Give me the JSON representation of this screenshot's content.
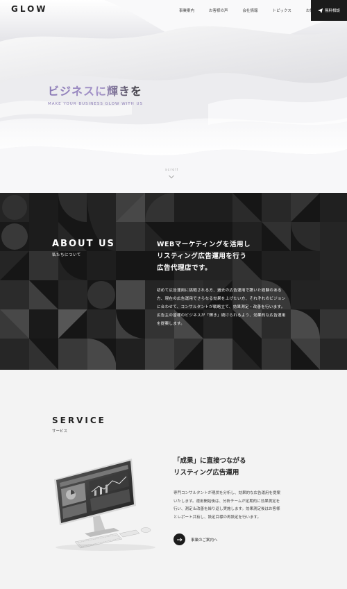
{
  "header": {
    "logo": "GLOW",
    "nav": [
      "事業案内",
      "お客様の声",
      "会社情報",
      "トピックス",
      "お知らせ"
    ],
    "cta_label": "無料相談"
  },
  "hero": {
    "title": "ビジネスに輝きを",
    "subtitle": "MAKE YOUR BUSINESS GLOW WITH US",
    "scroll": "scroll"
  },
  "about": {
    "title": "ABOUT US",
    "subtitle": "私たちについて",
    "lead": [
      "WEBマーケティングを活用し",
      "リスティング広告運用を行う",
      "広告代理店です。"
    ],
    "text": [
      "初めて広告運用に挑戦される方、過去の広告運用で躓いた経験のある",
      "方、現在の広告運用でさらなる効果を上げたい方、それぞれのビジョン",
      "に合わせて、コンサルタントが戦略立て、効果測定・改善を行います。",
      "広告主の皆様のビジネスが「輝き」続けられるよう、効果的な広告運用",
      "を提案します。"
    ]
  },
  "service": {
    "title": "SERVICE",
    "subtitle": "サービス",
    "lead": [
      "「成果」に直接つながる",
      "リスティング広告運用"
    ],
    "text": [
      "専門コンサルタントが現状を分析し、効果的な広告運用を提案",
      "いたします。運用開始後は、分析チームが定期的に効果測定を",
      "行い、測定＆改善を繰り返し実施します。効果測定後はお客様",
      "とレポート共有し、設定目標の再設定を行います。"
    ],
    "link_label": "事業のご案内へ"
  }
}
